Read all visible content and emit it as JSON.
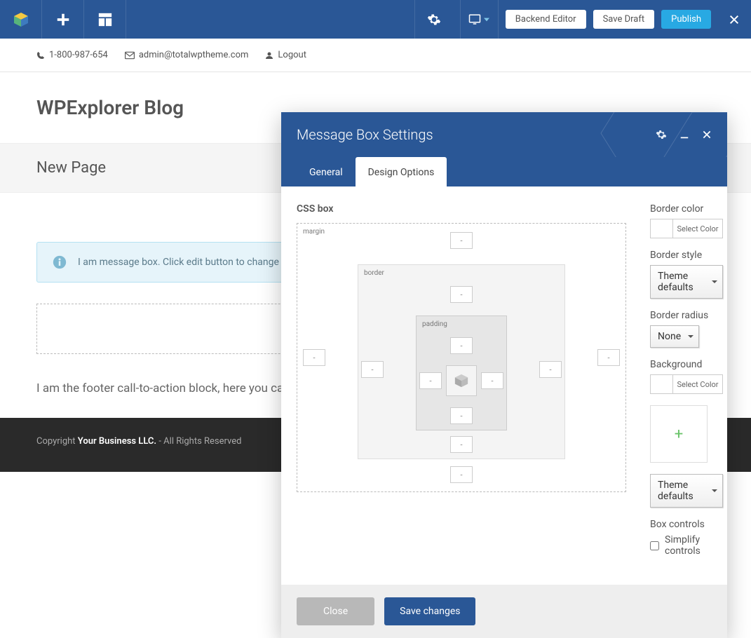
{
  "topbar": {
    "backend_editor": "Backend Editor",
    "save_draft": "Save Draft",
    "publish": "Publish"
  },
  "utilbar": {
    "phone": "1-800-987-654",
    "email": "admin@totalwptheme.com",
    "logout": "Logout"
  },
  "page": {
    "site_title": "WPExplorer Blog",
    "section_title": "New Page",
    "message": "I am message box. Click edit button to change thi",
    "footer_text": "I am the footer call-to-action block, here you can add some relevant/important information about your company or product.",
    "copyright_prefix": "Copyright ",
    "copyright_company": "Your Business LLC.",
    "copyright_suffix": " - All Rights Reserved"
  },
  "modal": {
    "title": "Message Box Settings",
    "tabs": {
      "general": "General",
      "design": "Design Options"
    },
    "cssbox_label": "CSS box",
    "layer_margin": "margin",
    "layer_border": "border",
    "layer_padding": "padding",
    "dash": "-",
    "border_color_label": "Border color",
    "select_color": "Select Color",
    "border_style_label": "Border style",
    "border_style_value": "Theme defaults",
    "border_radius_label": "Border radius",
    "border_radius_value": "None",
    "background_label": "Background",
    "bg_select_value": "Theme defaults",
    "box_controls_label": "Box controls",
    "simplify_label": "Simplify controls",
    "close_btn": "Close",
    "save_btn": "Save changes"
  }
}
